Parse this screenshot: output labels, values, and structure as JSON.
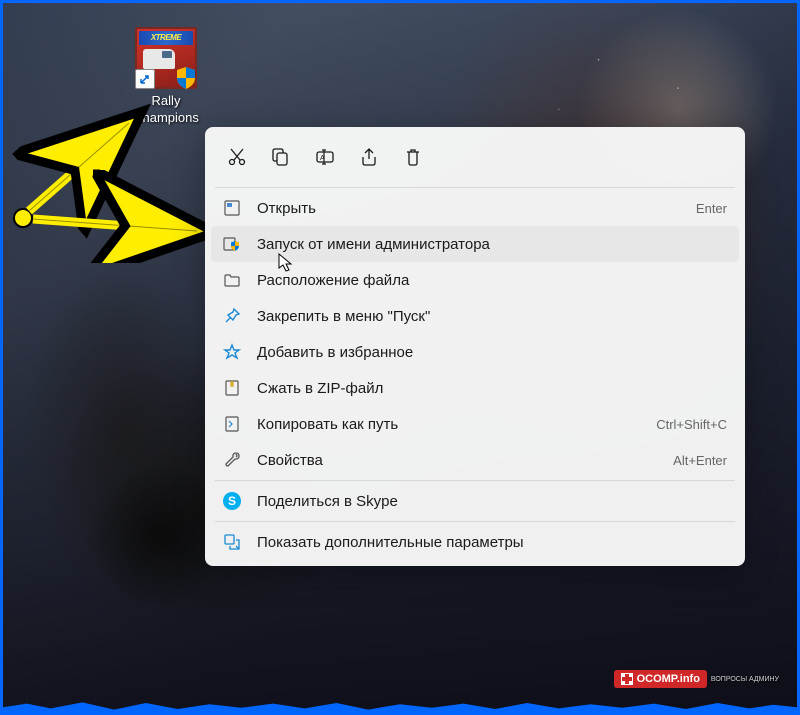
{
  "desktop_icon": {
    "label": "Rally Champions",
    "banner_text": "XTREME"
  },
  "context_menu": {
    "top_actions": [
      {
        "name": "cut",
        "icon": "scissors"
      },
      {
        "name": "copy",
        "icon": "copy"
      },
      {
        "name": "rename",
        "icon": "rename"
      },
      {
        "name": "share",
        "icon": "share"
      },
      {
        "name": "delete",
        "icon": "trash"
      }
    ],
    "items": [
      {
        "label": "Открыть",
        "shortcut": "Enter",
        "icon": "open"
      },
      {
        "label": "Запуск от имени администратора",
        "shortcut": "",
        "icon": "admin-shield",
        "hovered": true
      },
      {
        "label": "Расположение файла",
        "shortcut": "",
        "icon": "folder"
      },
      {
        "label": "Закрепить в меню \"Пуск\"",
        "shortcut": "",
        "icon": "pin"
      },
      {
        "label": "Добавить в избранное",
        "shortcut": "",
        "icon": "star"
      },
      {
        "label": "Сжать в ZIP-файл",
        "shortcut": "",
        "icon": "zip"
      },
      {
        "label": "Копировать как путь",
        "shortcut": "Ctrl+Shift+C",
        "icon": "copy-path"
      },
      {
        "label": "Свойства",
        "shortcut": "Alt+Enter",
        "icon": "properties"
      },
      {
        "separator": true
      },
      {
        "label": "Поделиться в Skype",
        "shortcut": "",
        "icon": "skype"
      },
      {
        "separator": true
      },
      {
        "label": "Показать дополнительные параметры",
        "shortcut": "",
        "icon": "more"
      }
    ]
  },
  "watermark": {
    "text": "OCOMP.info",
    "subtitle": "ВОПРОСЫ АДМИНУ"
  }
}
